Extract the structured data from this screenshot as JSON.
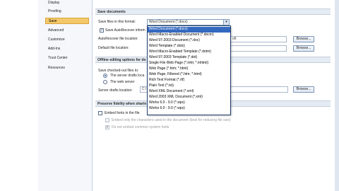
{
  "sidebar": {
    "items": [
      {
        "label": "Display"
      },
      {
        "label": "Proofing"
      },
      {
        "label": "Save",
        "active": true
      },
      {
        "label": "Advanced"
      },
      {
        "label": "Customize"
      },
      {
        "label": "Add-Ins"
      },
      {
        "label": "Trust Center"
      },
      {
        "label": "Resources"
      }
    ]
  },
  "save_documents": {
    "header": "Save documents",
    "format_label": "Save files in this format:",
    "format_value": "Word Document (*.docx)",
    "autorecover_label": "Save AutoRecover inform",
    "autorecover_location_label": "AutoRecover file location:",
    "autorecover_location_value": "oft",
    "default_location_label": "Default file location:",
    "browse_label": "Browse..."
  },
  "offline": {
    "header": "Offline editing options for do",
    "checked_out_label": "Save checked-out files to:",
    "radio1_label": "The server drafts loca",
    "radio2_label": "The web server",
    "drafts_location_label": "Server drafts location:",
    "drafts_location_value": "C:\\",
    "browse_label": "Browse..."
  },
  "fidelity": {
    "header": "Preserve fidelity when sharin",
    "embed_fonts_label": "Embed fonts in the file",
    "embed_only_label": "Embed only the characters used in the document (best for reducing file size)",
    "no_common_label": "Do not embed common system fonts"
  },
  "format_dropdown": {
    "options": [
      "Word Document (*.docx)",
      "Word Macro-Enabled Document (*.docm)",
      "Word 97-2003 Document (*.doc)",
      "Word Template (*.dotx)",
      "Word Macro-Enabled Template (*.dotm)",
      "Word 97-2003 Template (*.dot)",
      "Single File Web Page (*.mht; *.mhtml)",
      "Web Page (*.htm; *.html)",
      "Web Page, Filtered (*.htm; *.html)",
      "Rich Text Format (*.rtf)",
      "Plain Text (*.txt)",
      "Word XML Document (*.xml)",
      "Word 2003 XML Document (*.xml)",
      "Works 6.0 - 9.0 (*.wps)",
      "Works 6.0 - 9.0 (*.wps)"
    ],
    "selected_index": 0
  },
  "colors": {
    "selected_item": "#3469c0",
    "active_nav": "#f4c86a",
    "section_header_bg": "#e5ebf3"
  }
}
